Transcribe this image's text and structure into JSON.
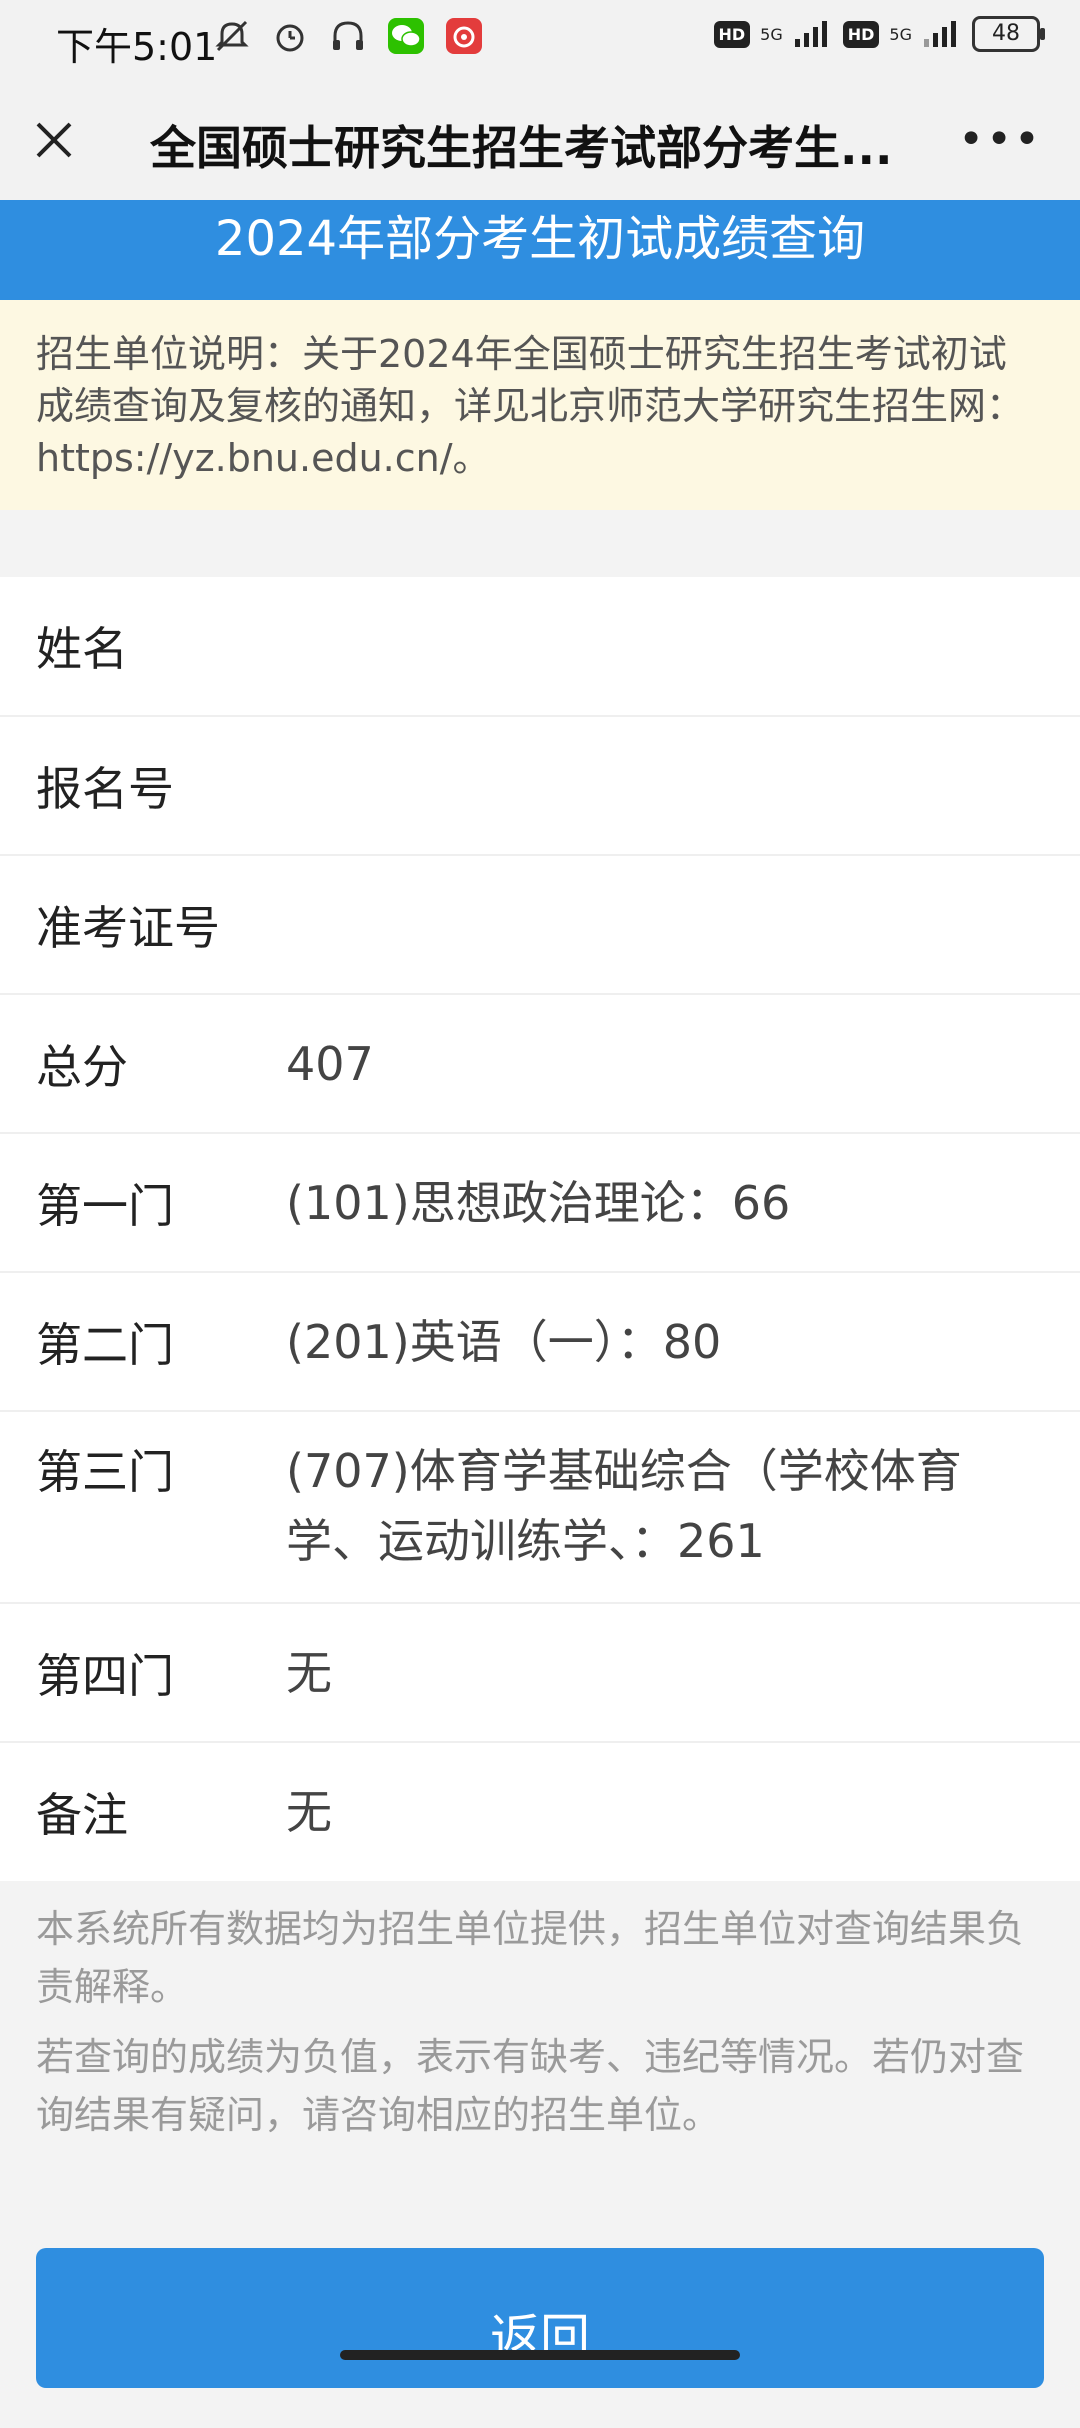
{
  "status_bar": {
    "time": "下午5:01",
    "hd1": "HD",
    "sig1": "5G",
    "hd2": "HD",
    "sig2": "5G",
    "battery": "48"
  },
  "nav": {
    "title": "全国硕士研究生招生考试部分考生...",
    "more": "•••"
  },
  "header": {
    "title": "2024年部分考生初试成绩查询"
  },
  "notice": {
    "text": "招生单位说明：关于2024年全国硕士研究生招生考试初试成绩查询及复核的通知，详见北京师范大学研究生招生网：https://yz.bnu.edu.cn/。"
  },
  "rows": [
    {
      "label": "姓名",
      "value": ""
    },
    {
      "label": "报名号",
      "value": ""
    },
    {
      "label": "准考证号",
      "value": ""
    },
    {
      "label": "总分",
      "value": "407"
    },
    {
      "label": "第一门",
      "value": "(101)思想政治理论：66"
    },
    {
      "label": "第二门",
      "value": "(201)英语（一）：80"
    },
    {
      "label": "第三门",
      "value": "(707)体育学基础综合（学校体育学、运动训练学、：261"
    },
    {
      "label": "第四门",
      "value": "无"
    },
    {
      "label": "备注",
      "value": "无"
    }
  ],
  "footer": {
    "line1": "本系统所有数据均为招生单位提供，招生单位对查询结果负责解释。",
    "line2": "若查询的成绩为负值，表示有缺考、违纪等情况。若仍对查询结果有疑问，请咨询相应的招生单位。"
  },
  "back_button": "返回",
  "colors": {
    "accent": "#2f8ee0",
    "notice_bg": "#fdf8e2"
  }
}
